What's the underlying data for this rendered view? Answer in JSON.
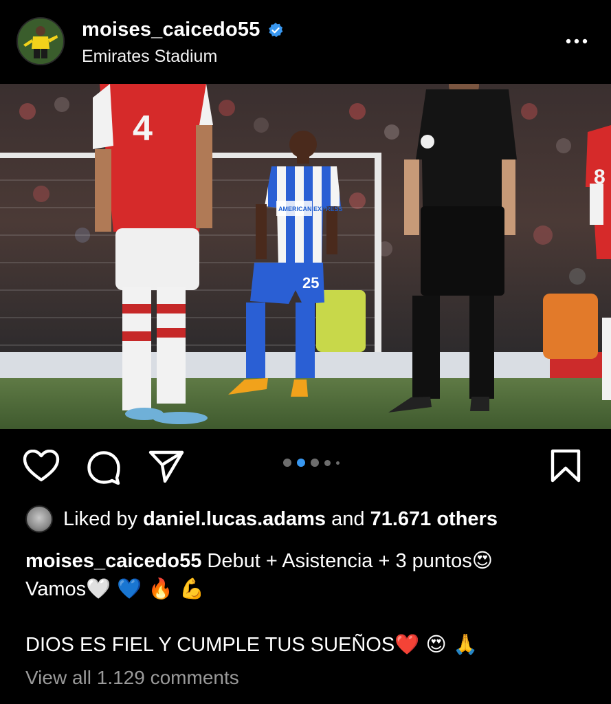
{
  "post": {
    "username": "moises_caicedo55",
    "location": "Emirates Stadium",
    "verified_icon": "verified-badge-icon",
    "more_icon": "more-horizontal-icon"
  },
  "photo": {
    "jersey_numbers": {
      "left_player": "4",
      "center_player": "25",
      "right_player": "8"
    },
    "sponsor_text": "AMERICAN EXPRESS"
  },
  "actions": {
    "like_icon": "heart-icon",
    "comment_icon": "comment-icon",
    "share_icon": "send-icon",
    "save_icon": "bookmark-icon",
    "carousel_active_index": 2,
    "carousel_visible_dots": 5
  },
  "likes": {
    "prefix": "Liked by",
    "liker": "daniel.lucas.adams",
    "middle": "and",
    "others": "71.671 others"
  },
  "caption": {
    "username": "moises_caicedo55",
    "line1": "Debut + Asistencia + 3 puntos",
    "line1_emoji": "😍",
    "line2": "Vamos",
    "line2_emojis": "🤍 💙 🔥 💪",
    "line3": "DIOS ES FIEL Y CUMPLE TUS SUEÑOS",
    "line3_emojis": "❤️ 😍 🙏"
  },
  "comments": {
    "view_all": "View all 1.129 comments"
  },
  "colors": {
    "background": "#000000",
    "accent_blue": "#3897f0",
    "muted_text": "#9a9a9a",
    "arsenal_red": "#d62a2a",
    "brighton_blue": "#1f5fd0"
  }
}
